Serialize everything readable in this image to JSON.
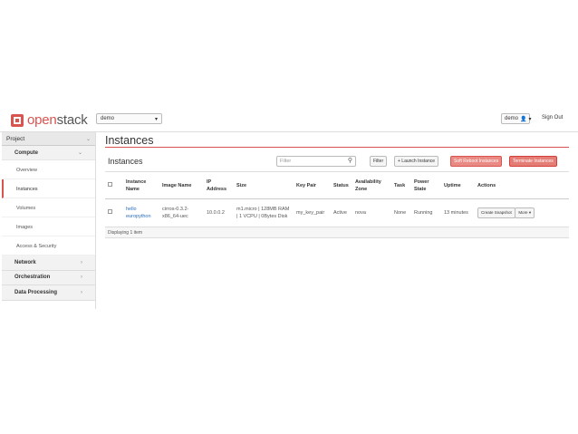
{
  "brand": {
    "prefix": "open",
    "suffix": "stack"
  },
  "header": {
    "project": "demo",
    "user": "demo",
    "signout": "Sign Out"
  },
  "sidebar": {
    "project_label": "Project",
    "compute_label": "Compute",
    "items": [
      {
        "label": "Overview"
      },
      {
        "label": "Instances"
      },
      {
        "label": "Volumes"
      },
      {
        "label": "Images"
      },
      {
        "label": "Access & Security"
      }
    ],
    "sections": [
      {
        "label": "Network"
      },
      {
        "label": "Orchestration"
      },
      {
        "label": "Data Processing"
      }
    ]
  },
  "main": {
    "page_title": "Instances",
    "panel_title": "Instances",
    "filter_placeholder": "Filter",
    "filter_button": "Filter",
    "launch_button": "+ Launch Instance",
    "soft_reboot_button": "Soft Reboot Instances",
    "terminate_button": "Terminate Instances",
    "columns": [
      "Instance Name",
      "Image Name",
      "IP Address",
      "Size",
      "Key Pair",
      "Status",
      "Availability Zone",
      "Task",
      "Power State",
      "Uptime",
      "Actions"
    ],
    "rows": [
      {
        "name": "hello europython",
        "image": "cirros-0.3.2-x86_64-uec",
        "ip": "10.0.0.2",
        "size": "m1.micro | 128MB RAM | 1 VCPU | 0Bytes Disk",
        "key_pair": "my_key_pair",
        "status": "Active",
        "zone": "nova",
        "task": "None",
        "power": "Running",
        "uptime": "13 minutes",
        "action": "Create Snapshot",
        "more": "More"
      }
    ],
    "footer": "Displaying 1 item"
  }
}
